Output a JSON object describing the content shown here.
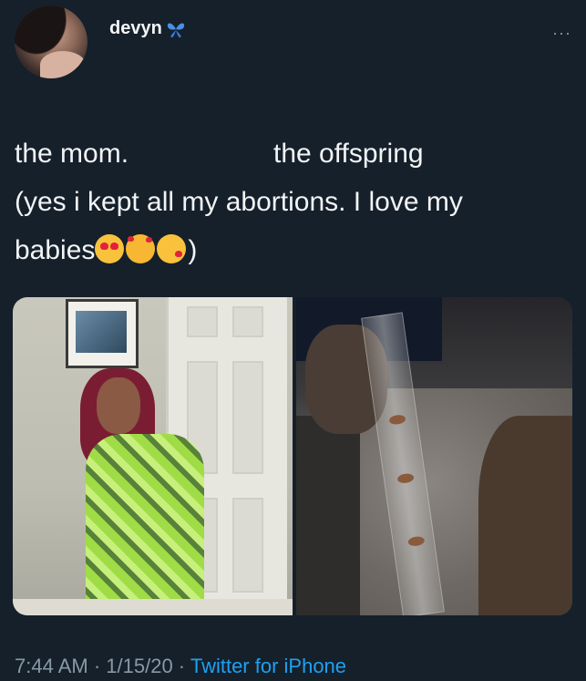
{
  "user": {
    "name": "devyn",
    "badge_icon": "butterfly-icon",
    "badge_color": "#4a90e2"
  },
  "menu": {
    "more_label": "···"
  },
  "tweet": {
    "text_col1": "the mom.",
    "text_col2": "the offspring",
    "text_line2": "(yes i kept all my abortions. I love my",
    "text_line3_prefix": "babies",
    "text_line3_suffix": ")",
    "emojis": [
      "heart-eyes-emoji",
      "smiling-face-with-hearts-emoji",
      "face-blowing-kiss-emoji"
    ]
  },
  "media": {
    "left_image": "photo-woman-in-snakeskin-outfit",
    "right_image": "photo-hand-holding-clear-tube"
  },
  "footer": {
    "time": "7:44 AM",
    "separator": " · ",
    "date": "1/15/20",
    "separator2": " · ",
    "source": "Twitter for iPhone",
    "source_color": "#1da1f2"
  },
  "colors": {
    "background": "#15202b",
    "text": "#f2f4f6",
    "muted": "#8899a6"
  }
}
